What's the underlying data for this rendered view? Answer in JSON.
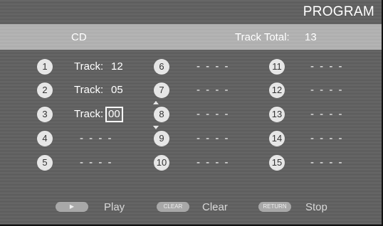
{
  "screen": {
    "title": "PROGRAM"
  },
  "header": {
    "source": "CD",
    "track_total_label": "Track Total:",
    "track_total_value": "13"
  },
  "slots": [
    {
      "num": "1",
      "label": "Track:",
      "value": "12"
    },
    {
      "num": "2",
      "label": "Track:",
      "value": "05"
    },
    {
      "num": "3",
      "label": "Track:",
      "value": "00",
      "editing": true
    },
    {
      "num": "4",
      "label": "",
      "value": "- - - -"
    },
    {
      "num": "5",
      "label": "",
      "value": "- - - -"
    },
    {
      "num": "6",
      "label": "",
      "value": "- - - -"
    },
    {
      "num": "7",
      "label": "",
      "value": "- - - -"
    },
    {
      "num": "8",
      "label": "",
      "value": "- - - -"
    },
    {
      "num": "9",
      "label": "",
      "value": "- - - -"
    },
    {
      "num": "10",
      "label": "",
      "value": "- - - -"
    },
    {
      "num": "11",
      "label": "",
      "value": "- - - -"
    },
    {
      "num": "12",
      "label": "",
      "value": "- - - -"
    },
    {
      "num": "13",
      "label": "",
      "value": "- - - -"
    },
    {
      "num": "14",
      "label": "",
      "value": "- - - -"
    },
    {
      "num": "15",
      "label": "",
      "value": "- - - -"
    }
  ],
  "footer": {
    "play": {
      "button_text": "▶",
      "label": "Play"
    },
    "clear": {
      "button_text": "CLEAR",
      "label": "Clear"
    },
    "stop": {
      "button_text": "RETURN",
      "label": "Stop"
    }
  }
}
